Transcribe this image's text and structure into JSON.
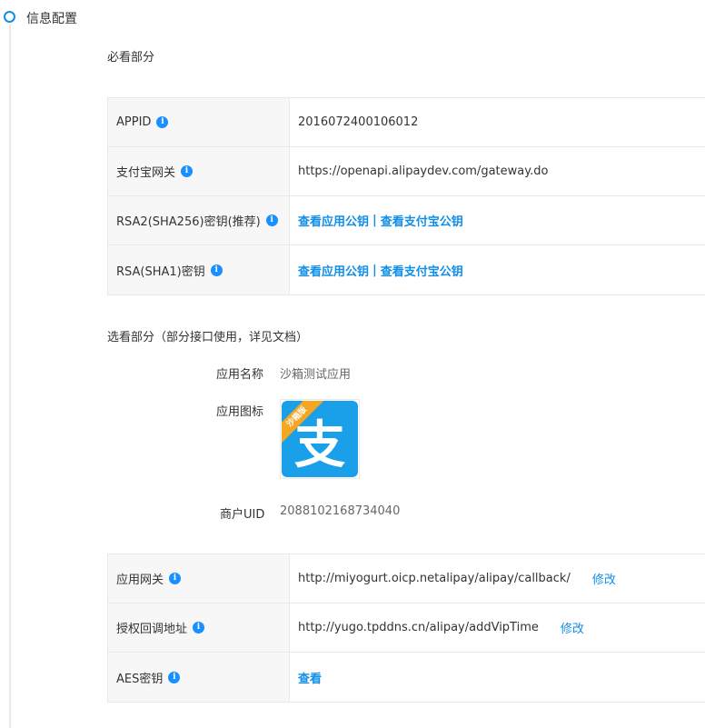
{
  "section": {
    "title": "信息配置"
  },
  "required": {
    "title": "必看部分",
    "rows": [
      {
        "label": "APPID",
        "value": "2016072400106012"
      },
      {
        "label": "支付宝网关",
        "value": "https://openapi.alipaydev.com/gateway.do"
      },
      {
        "label": "RSA2(SHA256)密钥(推荐)",
        "link1": "查看应用公钥",
        "sep": "|",
        "link2": "查看支付宝公钥"
      },
      {
        "label": "RSA(SHA1)密钥",
        "link1": "查看应用公钥",
        "sep": "|",
        "link2": "查看支付宝公钥"
      }
    ]
  },
  "optional": {
    "title": "选看部分（部分接口使用，详见文档）",
    "app_name_label": "应用名称",
    "app_name_value": "沙箱测试应用",
    "app_icon_label": "应用图标",
    "app_icon": {
      "ribbon": "沙箱版",
      "glyph": "支",
      "icon": "alipay-logo-icon"
    },
    "uid_label": "商户UID",
    "uid_value": "2088102168734040",
    "rows": [
      {
        "label": "应用网关",
        "value": "http://miyogurt.oicp.netalipay/alipay/callback/",
        "action": "修改"
      },
      {
        "label": "授权回调地址",
        "value": "http://yugo.tpddns.cn/alipay/addVipTime",
        "action": "修改"
      },
      {
        "label": "AES密钥",
        "link": "查看"
      }
    ]
  },
  "colors": {
    "accent": "#108ee9",
    "info_icon": "#1890ff",
    "label_bg": "#f7f7f7",
    "border": "#e9e9e9"
  },
  "info_icon_glyph": "i"
}
